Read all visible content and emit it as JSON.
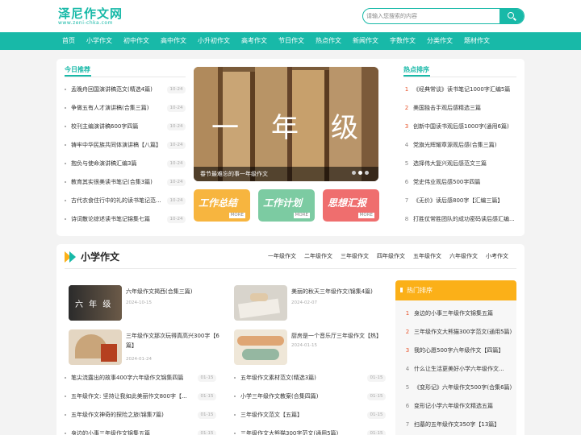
{
  "site": {
    "title": "泽尼作文网",
    "subtitle": "www.zeni-chka.com"
  },
  "search": {
    "placeholder": "请输入您搜索的内容"
  },
  "nav": [
    "首页",
    "小学作文",
    "初中作文",
    "高中作文",
    "小升初作文",
    "高考作文",
    "节日作文",
    "热点作文",
    "新闻作文",
    "字数作文",
    "分类作文",
    "题材作文"
  ],
  "today": {
    "title": "今日推荐",
    "items": [
      {
        "text": "孟晚舟回国演讲稿范文(精选4篇)",
        "date": "10-24"
      },
      {
        "text": "争做五有人才演讲稿(合集三篇)",
        "date": "10-24"
      },
      {
        "text": "校刊主编演讲稿600字四篇",
        "date": "10-24"
      },
      {
        "text": "铸牢中华民族共同体演讲稿【八篇】",
        "date": "10-24"
      },
      {
        "text": "抱负与使命演讲稿汇编3篇",
        "date": "10-24"
      },
      {
        "text": "教育其实很美读书笔记(合集3篇)",
        "date": "10-24"
      },
      {
        "text": "古代衣食住行中的礼的读书笔记范...",
        "date": "10-24"
      },
      {
        "text": "诗词散论综述读书笔记锦集七篇",
        "date": "10-24"
      }
    ]
  },
  "banner": {
    "big_text": [
      "一",
      "年",
      "级"
    ],
    "caption": "春节最难忘的事一年级作文"
  },
  "tiles": [
    {
      "label": "工作总结",
      "more": "MORE",
      "color": "#f7b53f"
    },
    {
      "label": "工作计划",
      "more": "MORE",
      "color": "#7ccba2"
    },
    {
      "label": "思想汇报",
      "more": "MORE",
      "color": "#ef6e6e"
    }
  ],
  "hot": {
    "title": "热点排序",
    "items": [
      "《经典常谈》读书笔记1000字汇编5篇",
      "美国独击手观后感精选三篇",
      "创新中国读书观后感1000字(通用6篇)",
      "党旗光辉耀章源观后感(合集三篇)",
      "选择伟大复兴观后感范文三篇",
      "党史伟业观后感500字四篇",
      "《无价》读后感800字【汇编三篇】",
      "打胜仗常胜团队的成功密码读后感汇编..."
    ]
  },
  "section": {
    "title": "小学作文",
    "tabs": [
      "一年级作文",
      "二年级作文",
      "三年级作文",
      "四年级作文",
      "五年级作文",
      "六年级作文",
      "小考作文"
    ]
  },
  "posts": [
    {
      "title": "六年级作文揭西(合集三篇)",
      "date": "2024-10-15",
      "thumb_text": "六 年 级"
    },
    {
      "title": "美丽的秋天三年级作文(锦集4篇)",
      "date": "2024-02-07"
    },
    {
      "title": "三年级作文那次玩得真高兴300字【6篇】",
      "date": "2024-01-24"
    },
    {
      "title": "厨房是一个音乐厅三年级作文【热】",
      "date": "2024-01-15"
    }
  ],
  "list_left": [
    {
      "text": "笔尖流露出的故事400字六年级作文锦集四篇",
      "date": "01-15"
    },
    {
      "text": "五年级作文: 坚持让我如此美丽作文800字【...",
      "date": "01-15"
    },
    {
      "text": "五年级作文神奇的探险之旅(锦集7篇)",
      "date": "01-15"
    },
    {
      "text": "身边的小事三年级作文锦集五篇",
      "date": "01-15"
    }
  ],
  "list_right": [
    {
      "text": "五年级作文素材范文(精选3篇)",
      "date": "01-15"
    },
    {
      "text": "小学三年级作文教案(合集四篇)",
      "date": "01-15"
    },
    {
      "text": "三年级作文范文【五篇】",
      "date": "01-15"
    },
    {
      "text": "三年级作文大熊猫300字范文(通用5篇)",
      "date": "01-15"
    }
  ],
  "side_hot": {
    "title": "热门排序",
    "items": [
      "身边的小事三年级作文锦集五篇",
      "三年级作文大熊猫300字范文(通用5篇)",
      "我的心愿500字六年级作文【四篇】",
      "什么让生活更美好小学六年级作文...",
      "《变形记》六年级作文500字(合集6篇)",
      "变形记小学六年级作文精选五篇",
      "扫墓的五年级作文350字【13篇】"
    ]
  },
  "colors": {
    "accent": "#18b9a8",
    "orange": "#fbb018",
    "rank_red": "#e8552c"
  }
}
